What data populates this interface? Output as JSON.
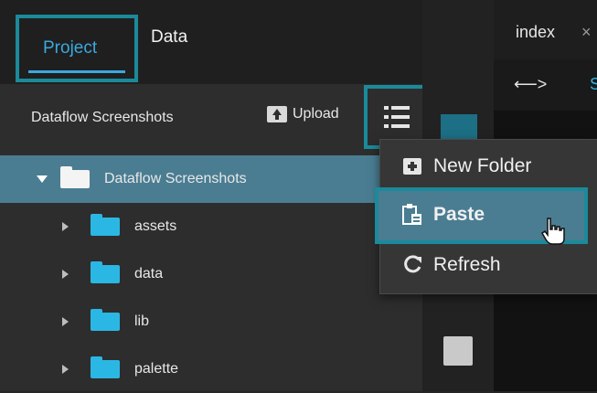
{
  "tabs": {
    "project": "Project",
    "data": "Data"
  },
  "sidebar": {
    "project_name": "Dataflow Screenshots",
    "upload_label": "Upload",
    "tree": [
      {
        "label": "Dataflow Screenshots",
        "expanded": true,
        "selected": true
      },
      {
        "label": "assets"
      },
      {
        "label": "data"
      },
      {
        "label": "lib"
      },
      {
        "label": "palette"
      }
    ]
  },
  "context_menu": {
    "items": [
      {
        "label": "New Folder",
        "icon": "plus-box-icon"
      },
      {
        "label": "Paste",
        "icon": "paste-icon"
      },
      {
        "label": "Refresh",
        "icon": "refresh-icon"
      }
    ]
  },
  "editor": {
    "tab_label": "index",
    "tab_close": "×",
    "nav_arrows": "⟵>",
    "nav_fragment": "S"
  },
  "colors": {
    "accent_teal": "#1b8a9b",
    "selection": "#4a7d92",
    "folder_cyan": "#2bb7e4",
    "link_blue": "#3aa9de"
  }
}
